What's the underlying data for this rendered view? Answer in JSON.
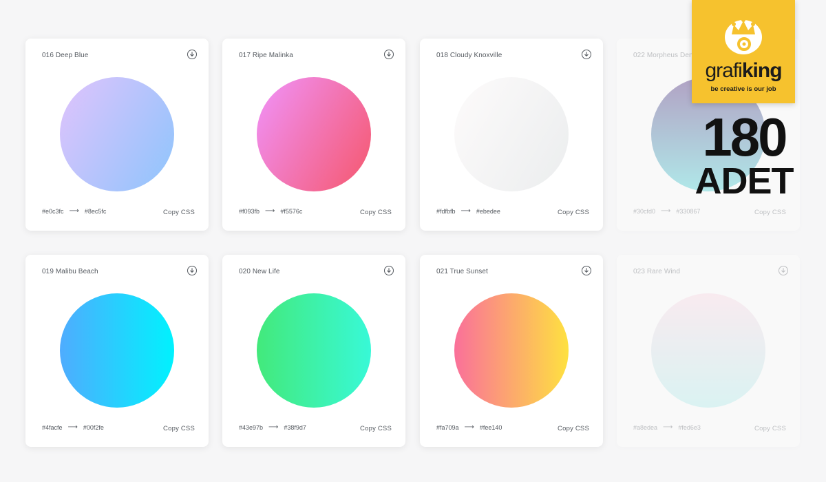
{
  "cards": [
    {
      "title": "016 Deep Blue",
      "from": "#e0c3fc",
      "to": "#8ec5fc",
      "copy_label": "Copy CSS",
      "faded": false
    },
    {
      "title": "017 Ripe Malinka",
      "from": "#f093fb",
      "to": "#f5576c",
      "copy_label": "Copy CSS",
      "faded": false
    },
    {
      "title": "018 Cloudy Knoxville",
      "from": "#fdfbfb",
      "to": "#ebedee",
      "copy_label": "Copy CSS",
      "faded": false
    },
    {
      "title": "022 Morpheus Den",
      "from": "#30cfd0",
      "to": "#330867",
      "copy_label": "Copy CSS",
      "faded": true
    },
    {
      "title": "019 Malibu Beach",
      "from": "#4facfe",
      "to": "#00f2fe",
      "copy_label": "Copy CSS",
      "faded": false
    },
    {
      "title": "020 New Life",
      "from": "#43e97b",
      "to": "#38f9d7",
      "copy_label": "Copy CSS",
      "faded": false
    },
    {
      "title": "021 True Sunset",
      "from": "#fa709a",
      "to": "#fee140",
      "copy_label": "Copy CSS",
      "faded": false
    },
    {
      "title": "023 Rare Wind",
      "from": "#a8edea",
      "to": "#fed6e3",
      "copy_label": "Copy CSS",
      "faded": true
    }
  ],
  "arrow": "⟶",
  "brand": {
    "name_part1": "grafi",
    "name_part2": "king",
    "tagline": "be creative is our job",
    "color": "#f6c22e"
  },
  "promo": {
    "count": "180",
    "unit": "ADET"
  },
  "icons": {
    "download": "download-circle-icon"
  }
}
